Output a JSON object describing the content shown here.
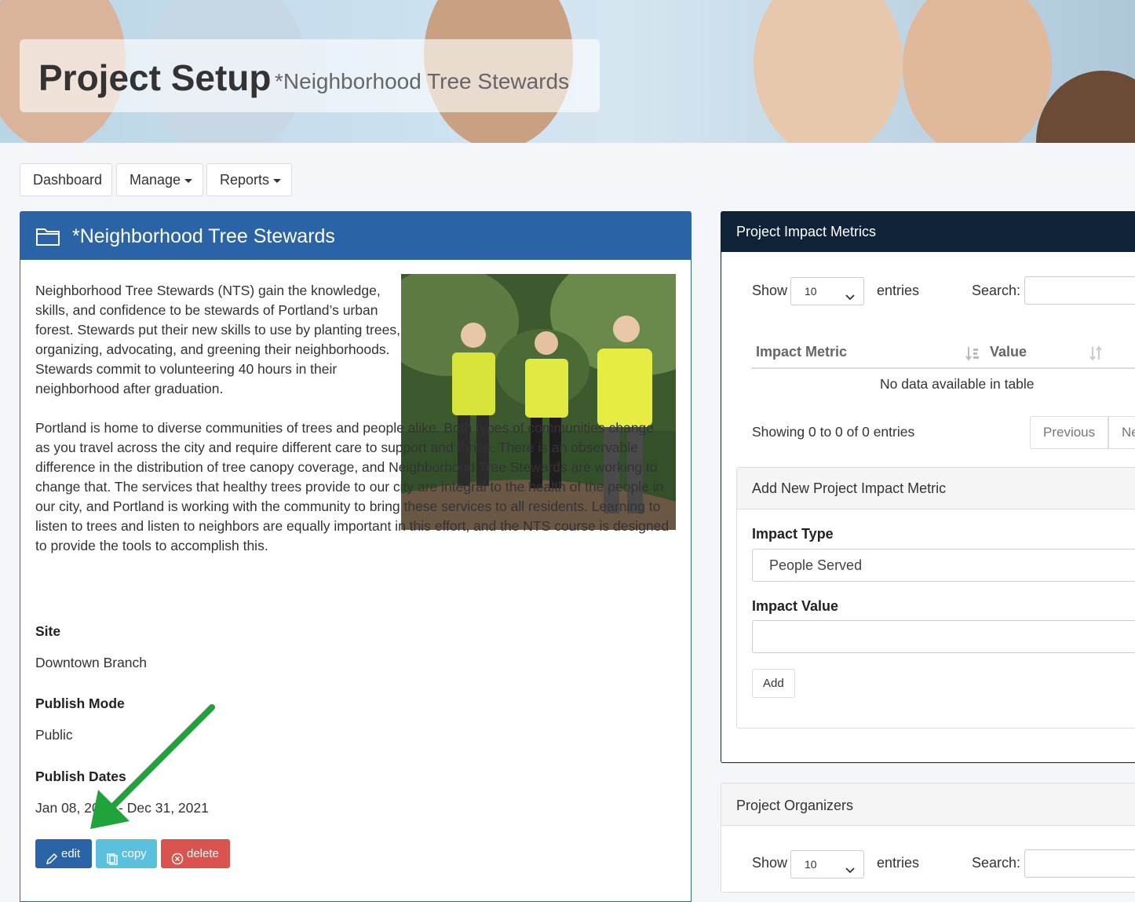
{
  "header": {
    "title": "Project Setup",
    "subtitle": "*Neighborhood Tree Stewards"
  },
  "nav": {
    "dashboard": "Dashboard",
    "manage": "Manage",
    "reports": "Reports"
  },
  "project": {
    "name": "*Neighborhood Tree Stewards",
    "description_p1": "Neighborhood Tree Stewards (NTS) gain the knowledge, skills, and confidence to be stewards of Portland’s urban forest. Stewards put their new skills to use by planting trees, organizing, advocating, and greening their neighborhoods. Stewards commit to volunteering 40 hours in their neighborhood after graduation.",
    "description_p2": "Portland is home to diverse communities of trees and people alike. Both types of communities change as you travel across the city and require different care to support and thrive. There is an observable difference in the distribution of tree canopy coverage, and Neighborhood Tree Stewards are working to change that. The services that healthy trees provide to our city are integral to the health of the people in our city, and Portland is working with the community to bring these services to all residents. Learning to listen to trees and listen to neighbors are equally important in this effort, and the NTS course is designed to provide the tools to accomplish this.",
    "site_label": "Site",
    "site_value": "Downtown Branch",
    "publish_mode_label": "Publish Mode",
    "publish_mode_value": "Public",
    "publish_dates_label": "Publish Dates",
    "publish_dates_value": "Jan 08, 2021 - Dec 31, 2021",
    "edit_label": "edit",
    "copy_label": "copy",
    "delete_label": "delete"
  },
  "metrics": {
    "title": "Project Impact Metrics",
    "show_label": "Show",
    "entries_value": "10",
    "entries_label": "entries",
    "search_label": "Search:",
    "col_metric": "Impact Metric",
    "col_value": "Value",
    "empty": "No data available in table",
    "showing": "Showing 0 to 0 of 0 entries",
    "previous": "Previous",
    "next": "Next"
  },
  "add_metric": {
    "title": "Add New Project Impact Metric",
    "impact_type_label": "Impact Type",
    "impact_type_value": "People Served",
    "impact_value_label": "Impact Value",
    "add_label": "Add"
  },
  "organizers": {
    "title": "Project Organizers",
    "show_label": "Show",
    "entries_value": "10",
    "entries_label": "entries",
    "search_label": "Search:"
  },
  "colors": {
    "primary": "#2a64a6",
    "dark_header": "#0f2238",
    "copy": "#5bc0de",
    "delete": "#d9534f",
    "arrow": "#1fa33a"
  }
}
